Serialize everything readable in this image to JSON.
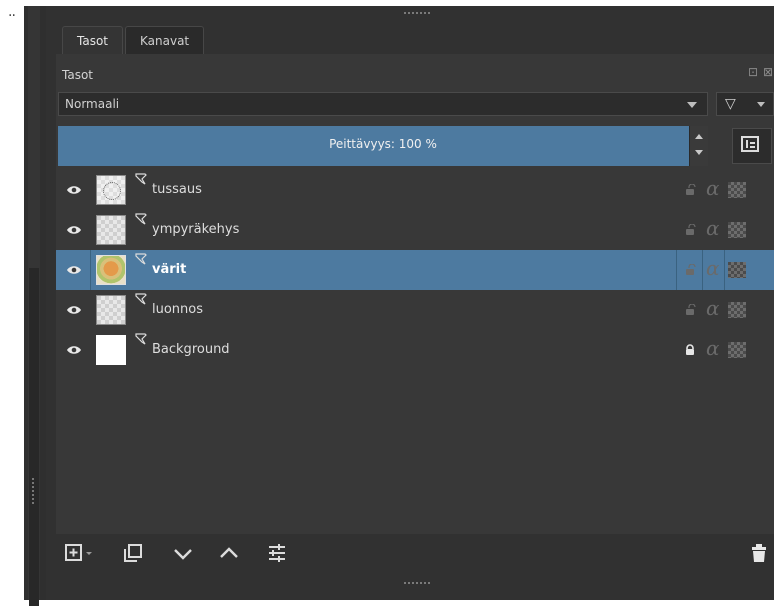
{
  "tabs": [
    {
      "label": "Tasot",
      "active": true
    },
    {
      "label": "Kanavat",
      "active": false
    }
  ],
  "panel": {
    "title": "Tasot",
    "blend_mode": "Normaali",
    "opacity_label": "Peittävyys:  100 %"
  },
  "layers": [
    {
      "name": "tussaus",
      "selected": false,
      "visible": true,
      "locked": false,
      "thumbnail": "inked"
    },
    {
      "name": "ympyräkehys",
      "selected": false,
      "visible": true,
      "locked": false,
      "thumbnail": "checker"
    },
    {
      "name": "värit",
      "selected": true,
      "visible": true,
      "locked": false,
      "thumbnail": "color"
    },
    {
      "name": "luonnos",
      "selected": false,
      "visible": true,
      "locked": false,
      "thumbnail": "checker"
    },
    {
      "name": "Background",
      "selected": false,
      "visible": true,
      "locked": true,
      "thumbnail": "white"
    }
  ],
  "icons": {
    "eye": "eye-icon",
    "lock": "lock-icon",
    "alpha": "alpha-icon",
    "inherit_alpha": "checker-icon",
    "add_layer": "add-layer-icon",
    "duplicate": "duplicate-icon",
    "move_down": "chevron-down-icon",
    "move_up": "chevron-up-icon",
    "properties": "sliders-icon",
    "delete": "trash-icon",
    "filter": "filter-icon"
  },
  "glyphs": {
    "alpha": "α"
  },
  "colors": {
    "selection": "#4d7aa0",
    "panel_bg": "#383838",
    "dock_bg": "#313131"
  }
}
